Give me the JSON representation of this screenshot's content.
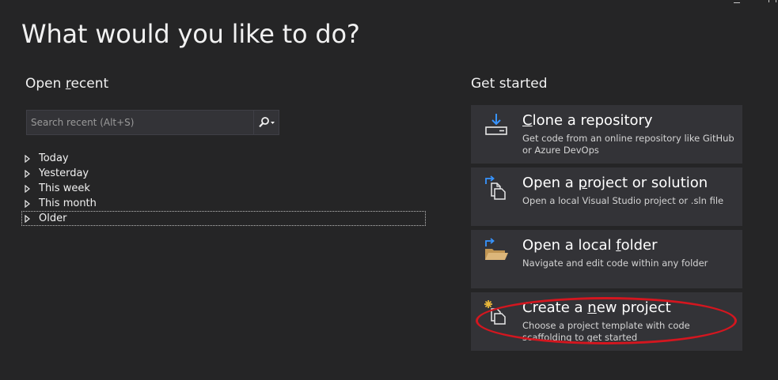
{
  "heading": "What would you like to do?",
  "open_recent": {
    "heading_parts": [
      "Open ",
      "r",
      "ecent"
    ],
    "search_placeholder": "Search recent (Alt+S)",
    "groups": [
      {
        "label": "Today"
      },
      {
        "label": "Yesterday"
      },
      {
        "label": "This week"
      },
      {
        "label": "This month"
      },
      {
        "label": "Older"
      }
    ]
  },
  "get_started": {
    "heading": "Get started",
    "cards": [
      {
        "title_parts": [
          "",
          "C",
          "lone a repository"
        ],
        "description": "Get code from an online repository like GitHub or Azure DevOps",
        "icon": "clone-icon"
      },
      {
        "title_parts": [
          "Open a ",
          "p",
          "roject or solution"
        ],
        "description": "Open a local Visual Studio project or .sln file",
        "icon": "open-project-icon"
      },
      {
        "title_parts": [
          "Open a local ",
          "f",
          "older"
        ],
        "description": "Navigate and edit code within any folder",
        "icon": "folder-icon"
      },
      {
        "title_parts": [
          "Create a ",
          "n",
          "ew project"
        ],
        "description": "Choose a project template with code scaffolding to get started",
        "icon": "new-project-icon"
      }
    ]
  },
  "colors": {
    "background": "#252526",
    "card": "#333337",
    "accent_blue": "#3794ff",
    "folder_yellow": "#dcb67a",
    "annotation_red": "#d4161f"
  }
}
